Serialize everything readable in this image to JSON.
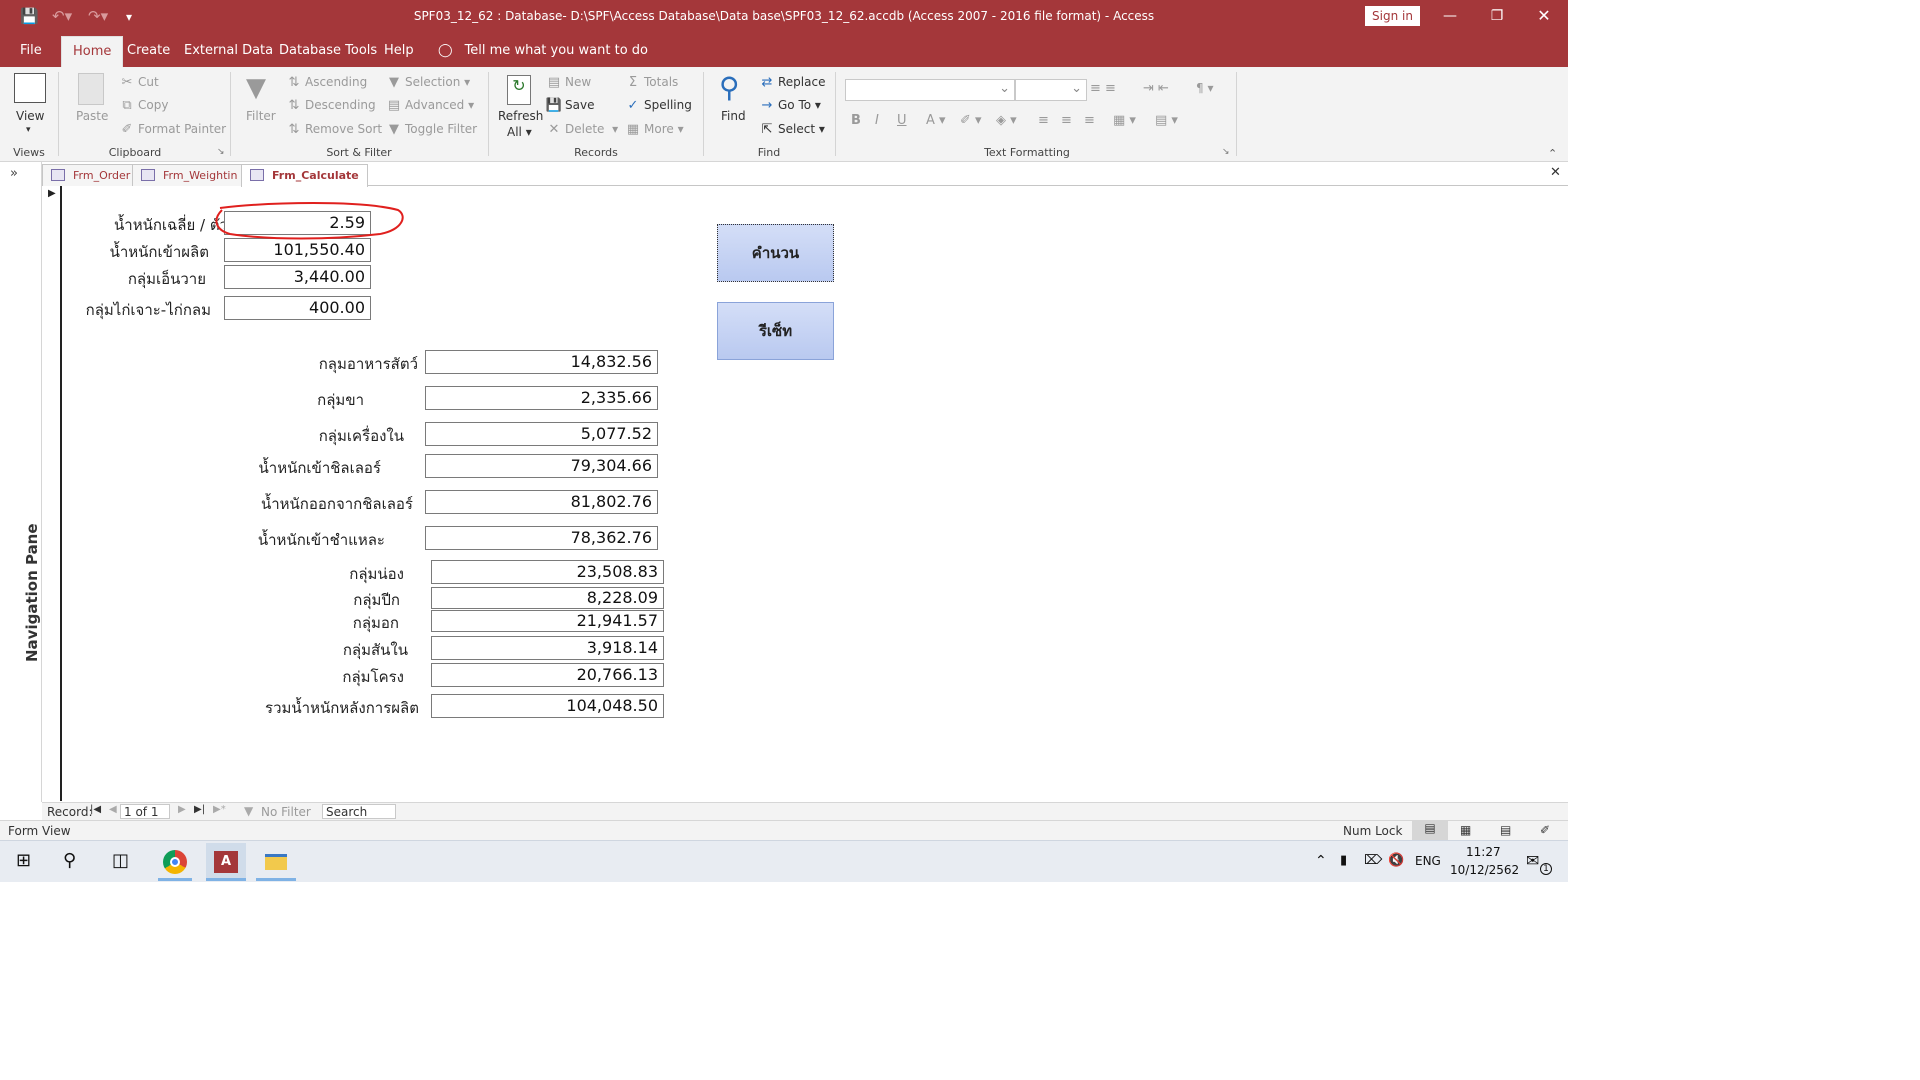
{
  "window": {
    "title": "SPF03_12_62 : Database- D:\\SPF\\Access Database\\Data base\\SPF03_12_62.accdb (Access 2007 - 2016 file format)  -  Access",
    "sign_in": "Sign in"
  },
  "menu": {
    "tabs": [
      "File",
      "Home",
      "Create",
      "External Data",
      "Database Tools",
      "Help"
    ],
    "active": "Home",
    "tell_me": "Tell me what you want to do"
  },
  "ribbon": {
    "views": {
      "view": "View",
      "group": "Views"
    },
    "clipboard": {
      "paste": "Paste",
      "cut": "Cut",
      "copy": "Copy",
      "format_painter": "Format Painter",
      "group": "Clipboard"
    },
    "sort_filter": {
      "filter": "Filter",
      "ascending": "Ascending",
      "descending": "Descending",
      "remove_sort": "Remove Sort",
      "selection": "Selection",
      "advanced": "Advanced",
      "toggle_filter": "Toggle Filter",
      "group": "Sort & Filter"
    },
    "records": {
      "refresh": "Refresh",
      "refresh_all": "All",
      "new": "New",
      "save": "Save",
      "delete": "Delete",
      "totals": "Totals",
      "spelling": "Spelling",
      "more": "More",
      "group": "Records"
    },
    "find": {
      "find": "Find",
      "replace": "Replace",
      "go_to": "Go To",
      "select": "Select",
      "group": "Find"
    },
    "text_formatting": {
      "group": "Text Formatting"
    }
  },
  "nav_pane": {
    "label": "Navigation Pane"
  },
  "doc_tabs": [
    {
      "label": "Frm_Order",
      "active": false
    },
    {
      "label": "Frm_Weightin",
      "active": false
    },
    {
      "label": "Frm_Calculate",
      "active": true
    }
  ],
  "form": {
    "top_fields": [
      {
        "label": "น้ำหนักเฉลี่ย / ตัว",
        "value": "2.59"
      },
      {
        "label": "น้ำหนักเข้าผลิต",
        "value": "101,550.40"
      },
      {
        "label": "กลุ่มเอ็นวาย",
        "value": "3,440.00"
      },
      {
        "label": "กลุ่มไก่เจาะ-ไก่กลม",
        "value": "400.00"
      }
    ],
    "mid_fields": [
      {
        "label": "กลุมอาหารสัตว์",
        "value": "14,832.56"
      },
      {
        "label": "กลุ่มขา",
        "value": "2,335.66"
      },
      {
        "label": "กลุ่มเครื่องใน",
        "value": "5,077.52"
      },
      {
        "label": "น้ำหนักเข้าชิลเลอร์",
        "value": "79,304.66"
      },
      {
        "label": "น้ำหนักออกจากชิลเลอร์",
        "value": "81,802.76"
      },
      {
        "label": "น้ำหนักเข้าชำแหละ",
        "value": "78,362.76"
      }
    ],
    "bottom_fields": [
      {
        "label": "กลุ่มน่อง",
        "value": "23,508.83"
      },
      {
        "label": "กลุ่มปีก",
        "value": "8,228.09"
      },
      {
        "label": "กลุ่มอก",
        "value": "21,941.57"
      },
      {
        "label": "กลุ่มสันใน",
        "value": "3,918.14"
      },
      {
        "label": "กลุ่มโครง",
        "value": "20,766.13"
      },
      {
        "label": "รวมน้ำหนักหลังการผลิต",
        "value": "104,048.50"
      }
    ],
    "calculate_button": "คำนวน",
    "reset_button": "รีเซ็ท"
  },
  "record_nav": {
    "label": "Record:",
    "position": "1 of 1",
    "filter": "No Filter",
    "search": "Search"
  },
  "status": {
    "view": "Form View",
    "num_lock": "Num Lock"
  },
  "taskbar": {
    "language": "ENG",
    "time": "11:27",
    "date": "10/12/2562",
    "notifications": "1"
  },
  "colors": {
    "accent": "#a4373a",
    "annotation": "#e0201e"
  }
}
